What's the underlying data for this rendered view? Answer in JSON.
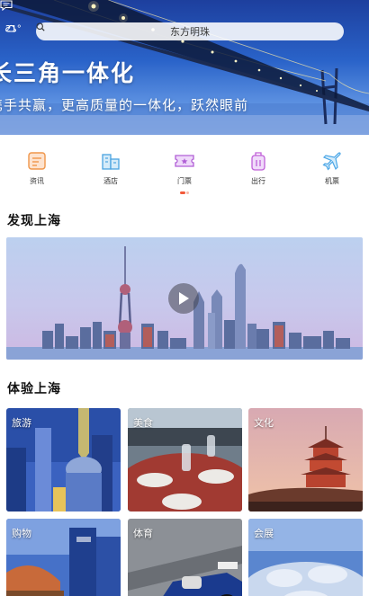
{
  "header": {
    "weather_temp": "21°",
    "search_text": "东方明珠"
  },
  "hero": {
    "title": "长三角一体化",
    "subtitle": "携手共赢，更高质量的一体化，跃然眼前"
  },
  "nav": {
    "items": [
      {
        "label": "资讯",
        "icon": "news-icon",
        "color": "#f0964a"
      },
      {
        "label": "酒店",
        "icon": "hotel-icon",
        "color": "#4aa3e0"
      },
      {
        "label": "门票",
        "icon": "ticket-icon",
        "color": "#b05fd6"
      },
      {
        "label": "出行",
        "icon": "luggage-icon",
        "color": "#c05fd8"
      },
      {
        "label": "机票",
        "icon": "airplane-icon",
        "color": "#49a5e6"
      }
    ],
    "active_page": 3,
    "page_count": 2
  },
  "discover": {
    "title": "发现上海",
    "video_icon": "play-icon"
  },
  "experience": {
    "title": "体验上海",
    "tiles": [
      {
        "label": "旅游"
      },
      {
        "label": "美食"
      },
      {
        "label": "文化"
      },
      {
        "label": "购物"
      },
      {
        "label": "体育"
      },
      {
        "label": "会展"
      }
    ]
  },
  "colors": {
    "accent": "#f25a3b",
    "hero_blue": "#2a63c9"
  }
}
